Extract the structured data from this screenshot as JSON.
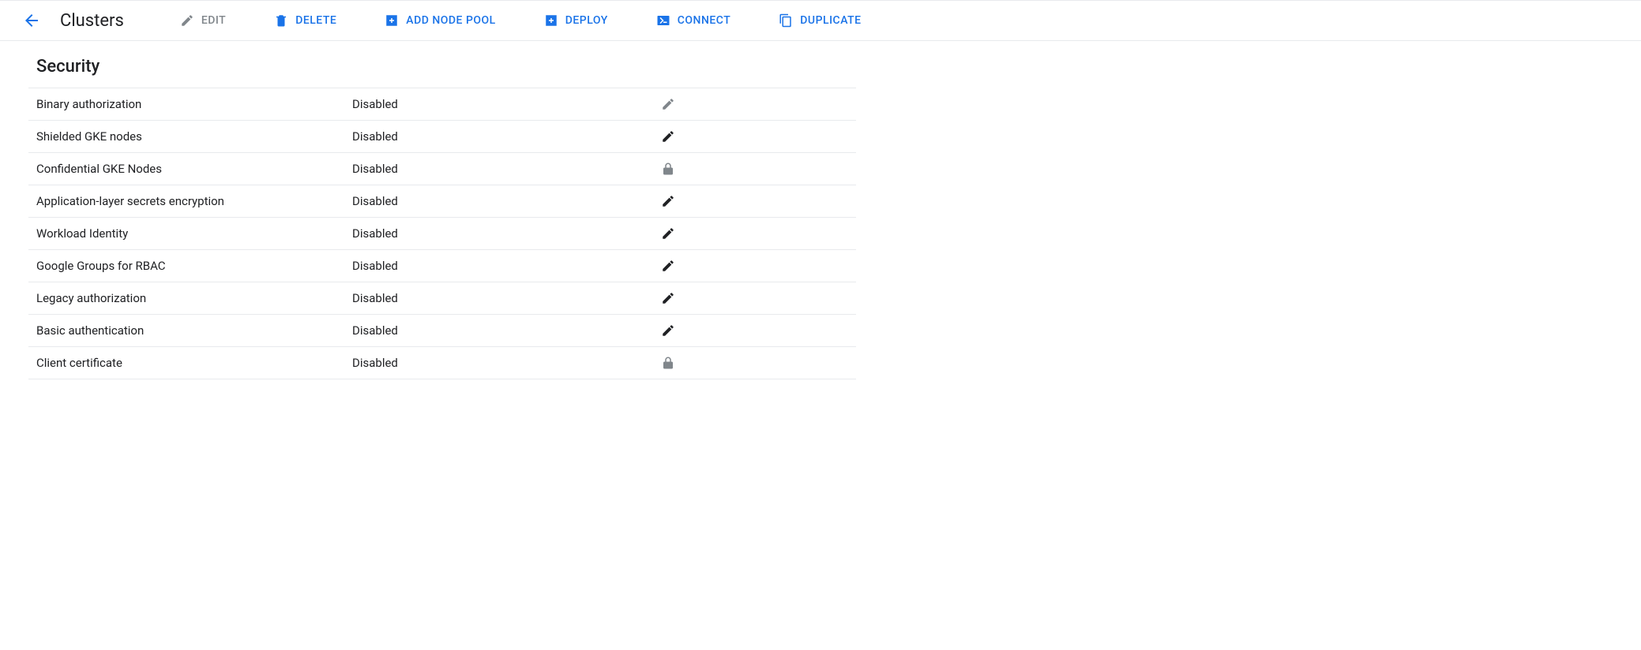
{
  "header": {
    "title": "Clusters",
    "actions": {
      "edit": "Edit",
      "delete": "Delete",
      "add_node_pool": "Add Node Pool",
      "deploy": "Deploy",
      "connect": "Connect",
      "duplicate": "Duplicate"
    }
  },
  "section": {
    "heading": "Security",
    "rows": [
      {
        "label": "Binary authorization",
        "value": "Disabled",
        "action": "edit-dim"
      },
      {
        "label": "Shielded GKE nodes",
        "value": "Disabled",
        "action": "edit"
      },
      {
        "label": "Confidential GKE Nodes",
        "value": "Disabled",
        "action": "lock"
      },
      {
        "label": "Application-layer secrets encryption",
        "value": "Disabled",
        "action": "edit"
      },
      {
        "label": "Workload Identity",
        "value": "Disabled",
        "action": "edit"
      },
      {
        "label": "Google Groups for RBAC",
        "value": "Disabled",
        "action": "edit"
      },
      {
        "label": "Legacy authorization",
        "value": "Disabled",
        "action": "edit"
      },
      {
        "label": "Basic authentication",
        "value": "Disabled",
        "action": "edit"
      },
      {
        "label": "Client certificate",
        "value": "Disabled",
        "action": "lock"
      }
    ]
  }
}
